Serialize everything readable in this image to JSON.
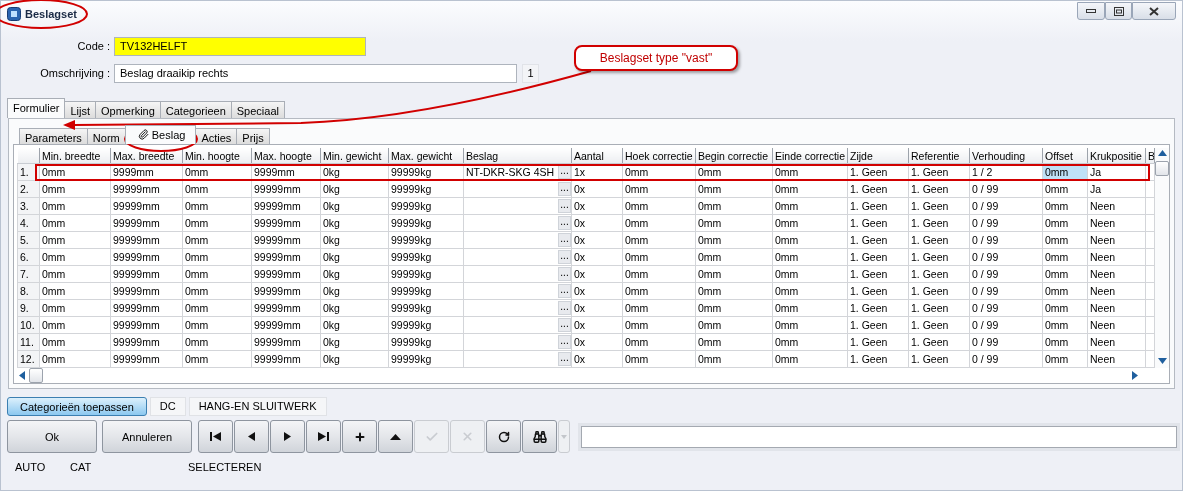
{
  "window": {
    "title": "Beslagset"
  },
  "header": {
    "code": {
      "label": "Code :",
      "value": "TV132HELFT"
    },
    "description": {
      "label": "Omschrijving :",
      "value": "Beslag draaikip rechts",
      "counter": "1"
    }
  },
  "tabs": [
    {
      "label": "Formulier",
      "selected": true
    },
    {
      "label": "Lijst",
      "selected": false
    },
    {
      "label": "Opmerking",
      "selected": false
    },
    {
      "label": "Categorieen",
      "selected": false
    },
    {
      "label": "Speciaal",
      "selected": false
    }
  ],
  "subtabs": [
    {
      "label": "Parameters",
      "selected": false
    },
    {
      "label": "Norm",
      "selected": false
    },
    {
      "label": "Beslag",
      "selected": true,
      "kind": "attachment"
    },
    {
      "label": "Acties",
      "selected": false
    },
    {
      "label": "Prijs",
      "selected": false
    }
  ],
  "table": {
    "columns": [
      {
        "label": "Min. breedte"
      },
      {
        "label": "Max. breedte"
      },
      {
        "label": "Min. hoogte"
      },
      {
        "label": "Max. hoogte"
      },
      {
        "label": "Min. gewicht"
      },
      {
        "label": "Max. gewicht"
      },
      {
        "label": "Beslag",
        "kind": "lookup"
      },
      {
        "label": "Aantal"
      },
      {
        "label": "Hoek correctie"
      },
      {
        "label": "Begin correctie"
      },
      {
        "label": "Einde correctie"
      },
      {
        "label": "Zijde"
      },
      {
        "label": "Referentie"
      },
      {
        "label": "Verhouding"
      },
      {
        "label": "Offset",
        "focused": true
      },
      {
        "label": "Krukpositie"
      },
      {
        "label": "B"
      }
    ],
    "rows": [
      {
        "label": "1.",
        "selected": true,
        "lookup_button": "...",
        "cells": [
          "0mm",
          "9999mm",
          "0mm",
          "9999mm",
          "0kg",
          "99999kg",
          "NT-DKR-SKG 4SH",
          "1x",
          "0mm",
          "0mm",
          "0mm",
          "1. Geen",
          "1. Geen",
          "1 / 2",
          "0mm",
          "Ja"
        ]
      },
      {
        "label": "2.",
        "selected": false,
        "lookup_button": "...",
        "cells": [
          "0mm",
          "99999mm",
          "0mm",
          "99999mm",
          "0kg",
          "99999kg",
          "",
          "0x",
          "0mm",
          "0mm",
          "0mm",
          "1. Geen",
          "1. Geen",
          "0 / 99",
          "0mm",
          "Ja"
        ]
      },
      {
        "label": "3.",
        "selected": false,
        "lookup_button": "...",
        "cells": [
          "0mm",
          "99999mm",
          "0mm",
          "99999mm",
          "0kg",
          "99999kg",
          "",
          "0x",
          "0mm",
          "0mm",
          "0mm",
          "1. Geen",
          "1. Geen",
          "0 / 99",
          "0mm",
          "Neen"
        ]
      },
      {
        "label": "4.",
        "selected": false,
        "lookup_button": "...",
        "cells": [
          "0mm",
          "99999mm",
          "0mm",
          "99999mm",
          "0kg",
          "99999kg",
          "",
          "0x",
          "0mm",
          "0mm",
          "0mm",
          "1. Geen",
          "1. Geen",
          "0 / 99",
          "0mm",
          "Neen"
        ]
      },
      {
        "label": "5.",
        "selected": false,
        "lookup_button": "...",
        "cells": [
          "0mm",
          "99999mm",
          "0mm",
          "99999mm",
          "0kg",
          "99999kg",
          "",
          "0x",
          "0mm",
          "0mm",
          "0mm",
          "1. Geen",
          "1. Geen",
          "0 / 99",
          "0mm",
          "Neen"
        ]
      },
      {
        "label": "6.",
        "selected": false,
        "lookup_button": "...",
        "cells": [
          "0mm",
          "99999mm",
          "0mm",
          "99999mm",
          "0kg",
          "99999kg",
          "",
          "0x",
          "0mm",
          "0mm",
          "0mm",
          "1. Geen",
          "1. Geen",
          "0 / 99",
          "0mm",
          "Neen"
        ]
      },
      {
        "label": "7.",
        "selected": false,
        "lookup_button": "...",
        "cells": [
          "0mm",
          "99999mm",
          "0mm",
          "99999mm",
          "0kg",
          "99999kg",
          "",
          "0x",
          "0mm",
          "0mm",
          "0mm",
          "1. Geen",
          "1. Geen",
          "0 / 99",
          "0mm",
          "Neen"
        ]
      },
      {
        "label": "8.",
        "selected": false,
        "lookup_button": "...",
        "cells": [
          "0mm",
          "99999mm",
          "0mm",
          "99999mm",
          "0kg",
          "99999kg",
          "",
          "0x",
          "0mm",
          "0mm",
          "0mm",
          "1. Geen",
          "1. Geen",
          "0 / 99",
          "0mm",
          "Neen"
        ]
      },
      {
        "label": "9.",
        "selected": false,
        "lookup_button": "...",
        "cells": [
          "0mm",
          "99999mm",
          "0mm",
          "99999mm",
          "0kg",
          "99999kg",
          "",
          "0x",
          "0mm",
          "0mm",
          "0mm",
          "1. Geen",
          "1. Geen",
          "0 / 99",
          "0mm",
          "Neen"
        ]
      },
      {
        "label": "10.",
        "selected": false,
        "lookup_button": "...",
        "cells": [
          "0mm",
          "99999mm",
          "0mm",
          "99999mm",
          "0kg",
          "99999kg",
          "",
          "0x",
          "0mm",
          "0mm",
          "0mm",
          "1. Geen",
          "1. Geen",
          "0 / 99",
          "0mm",
          "Neen"
        ]
      },
      {
        "label": "11.",
        "selected": false,
        "lookup_button": "...",
        "cells": [
          "0mm",
          "99999mm",
          "0mm",
          "99999mm",
          "0kg",
          "99999kg",
          "",
          "0x",
          "0mm",
          "0mm",
          "0mm",
          "1. Geen",
          "1. Geen",
          "0 / 99",
          "0mm",
          "Neen"
        ]
      },
      {
        "label": "12.",
        "selected": false,
        "lookup_button": "...",
        "cells": [
          "0mm",
          "99999mm",
          "0mm",
          "99999mm",
          "0kg",
          "99999kg",
          "",
          "0x",
          "0mm",
          "0mm",
          "0mm",
          "1. Geen",
          "1. Geen",
          "0 / 99",
          "0mm",
          "Neen"
        ]
      }
    ]
  },
  "category_bar": {
    "button": {
      "label": "Categorieën toepassen",
      "selected": true
    },
    "tags": [
      "DC",
      "HANG-EN SLUITWERK"
    ]
  },
  "actions": {
    "ok": "Ok",
    "cancel": "Annuleren",
    "navigation": [
      {
        "kind": "first",
        "disabled": false
      },
      {
        "kind": "previous",
        "disabled": false
      },
      {
        "kind": "next",
        "disabled": false
      },
      {
        "kind": "last",
        "disabled": false
      },
      {
        "kind": "add",
        "disabled": false
      },
      {
        "kind": "up",
        "disabled": false
      },
      {
        "kind": "confirm",
        "disabled": true
      },
      {
        "kind": "discard",
        "disabled": true
      },
      {
        "kind": "refresh",
        "disabled": false
      },
      {
        "kind": "find",
        "disabled": false
      }
    ]
  },
  "status_bar": [
    "AUTO",
    "CAT",
    "SELECTEREN"
  ],
  "annotation": {
    "callout": "Beslagset type \"vast\""
  }
}
